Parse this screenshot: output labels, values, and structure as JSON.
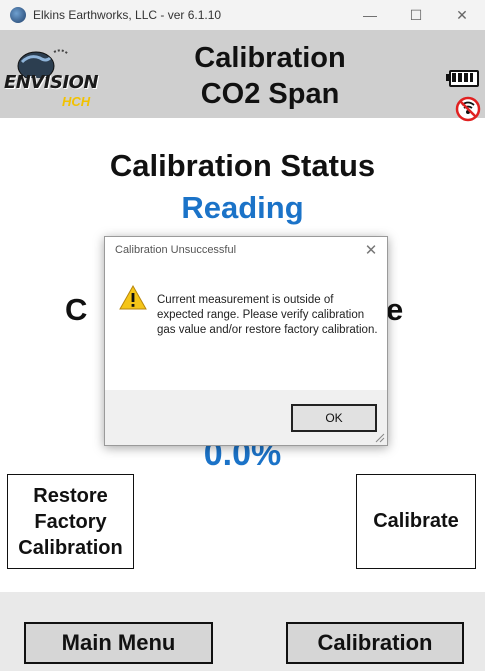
{
  "window": {
    "title": "Elkins Earthworks, LLC - ver 6.1.10",
    "minimize": "—",
    "maximize": "☐",
    "close": "✕"
  },
  "header": {
    "logo_word": "ENVISION",
    "logo_sub": "HCH",
    "title_line1": "Calibration",
    "title_line2": "CO2 Span",
    "battery_icon": "battery-full-icon",
    "signal_icon": "no-signal-icon"
  },
  "main": {
    "status_heading": "Calibration Status",
    "status_value": "Reading",
    "partial_label_left": "C",
    "partial_label_right": "e",
    "reading_value": "0.0%",
    "restore_button": [
      "Restore",
      "Factory",
      "Calibration"
    ],
    "calibrate_button": "Calibrate"
  },
  "footer": {
    "main_menu_button": "Main Menu",
    "calibration_button": "Calibration"
  },
  "dialog": {
    "title": "Calibration Unsuccessful",
    "close": "✕",
    "message": "Current measurement is outside of expected range. Please verify calibration gas value and/or restore factory calibration.",
    "ok_button": "OK",
    "icon": "warning-icon"
  },
  "colors": {
    "accent_blue": "#1b73c8",
    "header_gray": "#cfcfcf",
    "logo_yellow": "#f2c200"
  }
}
